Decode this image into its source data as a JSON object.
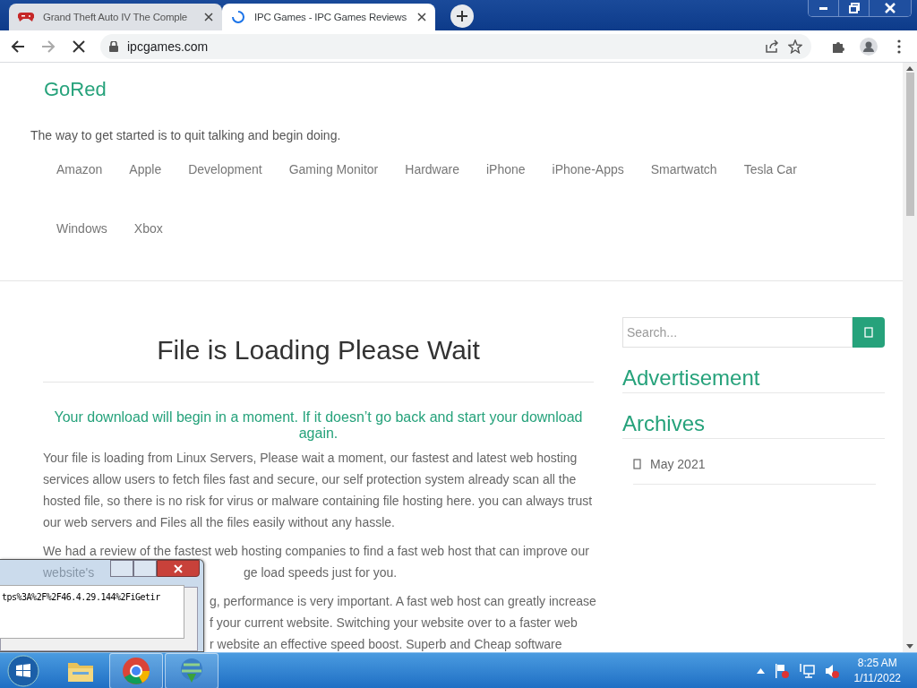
{
  "browser": {
    "tabs": [
      {
        "title": "Grand Theft Auto IV The Comple",
        "selected": false,
        "loading": false
      },
      {
        "title": "IPC Games - IPC Games Reviews",
        "selected": true,
        "loading": true
      }
    ],
    "address": "ipcgames.com"
  },
  "site": {
    "title": "GoRed",
    "tagline": "The way to get started is to quit talking and begin doing.",
    "nav": [
      "Amazon",
      "Apple",
      "Development",
      "Gaming Monitor",
      "Hardware",
      "iPhone",
      "iPhone-Apps",
      "Smartwatch",
      "Tesla Car",
      "Windows",
      "Xbox"
    ]
  },
  "article": {
    "heading": "File is Loading Please Wait",
    "notice": "Your download will begin in a moment. If it doesn’t go back and start your download again.",
    "blocks": [
      {
        "kind": "paragraph",
        "text": "Your file is loading from Linux Servers, Please wait a moment, our fastest and latest web hosting services allow users to fetch files fast and secure, our self protection system already scan all the hosted file, so there is no risk for virus or malware containing file hosting here. you can always trust our web servers and Files all the files easily without any hassle."
      },
      {
        "kind": "lines",
        "lines": [
          {
            "left": "We had a review of the fastest web hosting companies to find a fast web host that can improve our"
          },
          {
            "left": "website's",
            "right": "ge load speeds just for you."
          }
        ]
      },
      {
        "kind": "lines",
        "lines": [
          {
            "right": "g, performance is very important. A fast web host can greatly increase"
          },
          {
            "right": "f your current website. Switching your website over to a faster web"
          },
          {
            "right": "r website an effective speed boost. Superb and Cheap software"
          }
        ]
      }
    ]
  },
  "sidebar": {
    "search": {
      "placeholder": "Search..."
    },
    "widgets": [
      {
        "title": "Advertisement"
      },
      {
        "title": "Archives",
        "items": [
          "May 2021"
        ]
      }
    ]
  },
  "dialog": {
    "field_value": "tps%3A%2F%2F46.4.29.144%2FiGetir"
  },
  "taskbar": {
    "apps": [
      {
        "kind": "folder",
        "running": false
      },
      {
        "kind": "chrome",
        "running": true
      },
      {
        "kind": "downloader",
        "running": true
      }
    ],
    "time": "8:25 AM",
    "date": "1/11/2022"
  }
}
